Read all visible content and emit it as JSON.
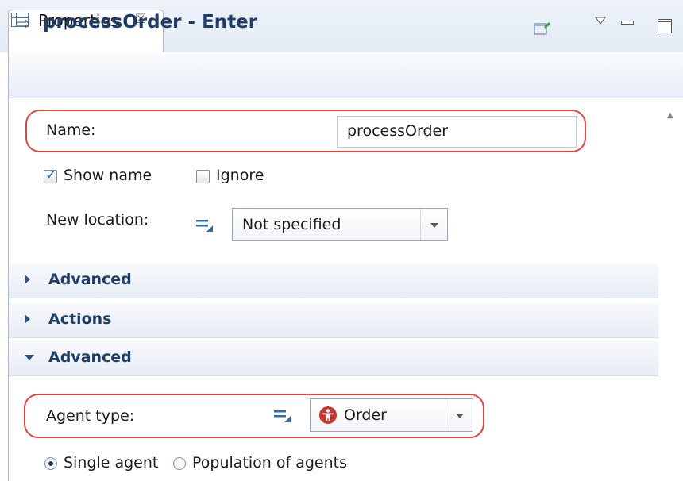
{
  "tab": {
    "label": "Properties",
    "close_glyph": "☒"
  },
  "header": {
    "title": "processOrder - Enter"
  },
  "form": {
    "name_label": "Name:",
    "name_value": "processOrder",
    "show_name_label": "Show name",
    "show_name_checked": true,
    "ignore_label": "Ignore",
    "ignore_checked": false,
    "new_location_label": "New location:",
    "new_location_value": "Not specified"
  },
  "sections": [
    {
      "label": "Advanced",
      "expanded": false
    },
    {
      "label": "Actions",
      "expanded": false
    },
    {
      "label": "Advanced",
      "expanded": true
    }
  ],
  "advanced": {
    "agent_type_label": "Agent type:",
    "agent_type_value": "Order",
    "mode_options": [
      "Single agent",
      "Population of agents"
    ],
    "selected_mode": "Single agent"
  },
  "colors": {
    "highlight": "#e3443f",
    "header_text": "#1e3e69",
    "agent_icon": "#c8332b"
  },
  "icons": [
    "table-icon",
    "pin-icon",
    "view-menu-icon",
    "minimize-icon",
    "maximize-icon",
    "enter-arrow-icon",
    "dynamic-value-icon",
    "agent-icon"
  ]
}
